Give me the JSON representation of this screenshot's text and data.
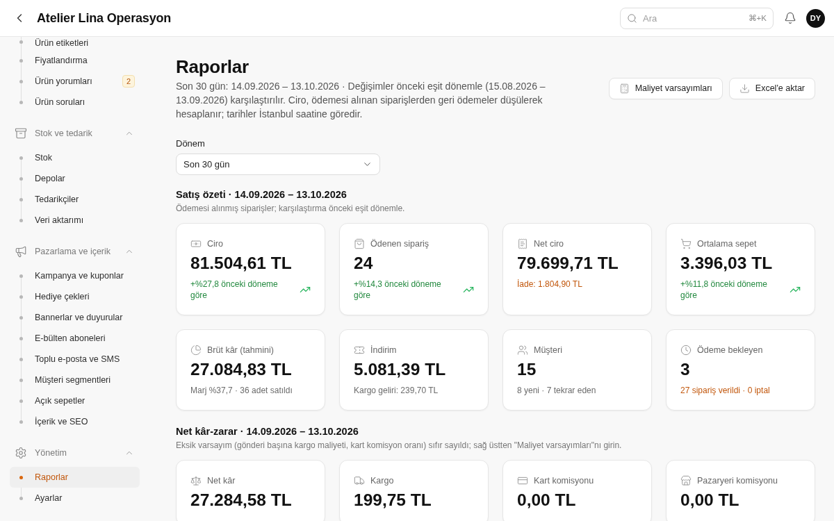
{
  "header": {
    "title": "Atelier Lina Operasyon",
    "search": {
      "placeholder": "Ara",
      "shortcut": "⌘+K"
    },
    "avatar": "DY"
  },
  "sidebar": {
    "groups": [
      {
        "items": [
          {
            "label": "Ürün etiketleri",
            "selected": false
          },
          {
            "label": "Fiyatlandırma",
            "selected": false
          },
          {
            "label": "Ürün yorumları",
            "selected": false,
            "badge": "2"
          },
          {
            "label": "Ürün soruları",
            "selected": false
          }
        ]
      },
      {
        "label": "Stok ve tedarik",
        "expanded": true,
        "items": [
          {
            "label": "Stok",
            "selected": false
          },
          {
            "label": "Depolar",
            "selected": false
          },
          {
            "label": "Tedarikçiler",
            "selected": false
          },
          {
            "label": "Veri aktarımı",
            "selected": false
          }
        ]
      },
      {
        "label": "Pazarlama ve içerik",
        "expanded": true,
        "items": [
          {
            "label": "Kampanya ve kuponlar",
            "selected": false
          },
          {
            "label": "Hediye çekleri",
            "selected": false
          },
          {
            "label": "Bannerlar ve duyurular",
            "selected": false
          },
          {
            "label": "E-bülten aboneleri",
            "selected": false
          },
          {
            "label": "Toplu e-posta ve SMS",
            "selected": false
          },
          {
            "label": "Müşteri segmentleri",
            "selected": false
          },
          {
            "label": "Açık sepetler",
            "selected": false
          },
          {
            "label": "İçerik ve SEO",
            "selected": false
          }
        ]
      },
      {
        "label": "Yönetim",
        "expanded": true,
        "items": [
          {
            "label": "Raporlar",
            "selected": true
          },
          {
            "label": "Ayarlar",
            "selected": false
          }
        ]
      }
    ]
  },
  "page": {
    "title": "Raporlar",
    "description": "Son 30 gün: 14.09.2026 – 13.10.2026 · Değişimler önceki eşit dönemle (15.08.2026 – 13.09.2026) karşılaştırılır. Ciro, ödemesi alınan siparişlerden geri ödemeler düşülerek hesaplanır; tarihler İstanbul saatine göredir.",
    "actions": [
      {
        "label": "Maliyet varsayımları"
      },
      {
        "label": "Excel'e aktar"
      }
    ],
    "period": {
      "label": "Dönem",
      "value": "Son 30 gün"
    },
    "sections": [
      {
        "title": "Satış özeti · 14.09.2026 – 13.10.2026",
        "subtitle": "Ödemesi alınmış siparişler; karşılaştırma önceki eşit dönemle.",
        "cards": [
          {
            "label": "Ciro",
            "value": "81.504,61 TL",
            "note": "+%27,8 önceki döneme göre",
            "kind": "positive",
            "trend": true
          },
          {
            "label": "Ödenen sipariş",
            "value": "24",
            "note": "+%14,3 önceki döneme göre",
            "kind": "positive",
            "trend": true
          },
          {
            "label": "Net ciro",
            "value": "79.699,71 TL",
            "note": "İade: 1.804,90 TL",
            "kind": "warning",
            "trend": false
          },
          {
            "label": "Ortalama sepet",
            "value": "3.396,03 TL",
            "note": "+%11,8 önceki döneme göre",
            "kind": "positive",
            "trend": true
          },
          {
            "label": "Brüt kâr (tahmini)",
            "value": "27.084,83 TL",
            "note": "Marj %37,7 · 36 adet satıldı",
            "kind": "muted",
            "trend": false
          },
          {
            "label": "İndirim",
            "value": "5.081,39 TL",
            "note": "Kargo geliri: 239,70 TL",
            "kind": "muted",
            "trend": false
          },
          {
            "label": "Müşteri",
            "value": "15",
            "note": "8 yeni · 7 tekrar eden",
            "kind": "muted",
            "trend": false
          },
          {
            "label": "Ödeme bekleyen",
            "value": "3",
            "note": "27 sipariş verildi · 0 iptal",
            "kind": "warning",
            "trend": false
          }
        ]
      },
      {
        "title": "Net kâr-zarar · 14.09.2026 – 13.10.2026",
        "subtitle": "Eksik varsayım (gönderi başına kargo maliyeti, kart komisyon oranı) sıfır sayıldı; sağ üstten \"Maliyet varsayımları\"nı girin.",
        "cards": [
          {
            "label": "Net kâr",
            "value": "27.284,58 TL"
          },
          {
            "label": "Kargo",
            "value": "199,75 TL"
          },
          {
            "label": "Kart komisyonu",
            "value": "0,00 TL"
          },
          {
            "label": "Pazaryeri komisyonu",
            "value": "0,00 TL"
          }
        ]
      }
    ]
  }
}
